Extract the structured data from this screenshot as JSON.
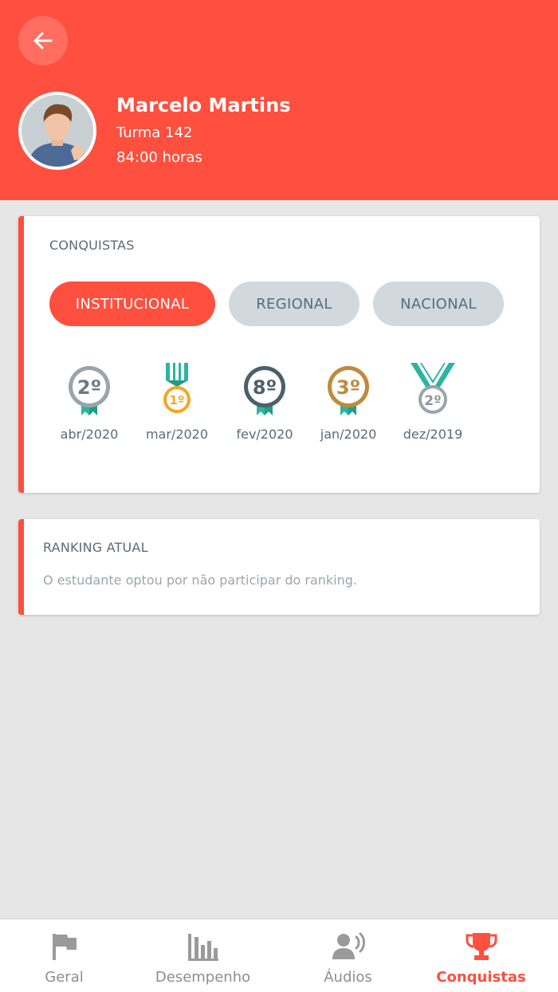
{
  "header": {
    "name": "Marcelo Martins",
    "class": "Turma 142",
    "hours": "84:00 horas",
    "color": "#ff4f3e"
  },
  "achievements": {
    "title": "CONQUISTAS",
    "tabs": [
      {
        "label": "INSTITUCIONAL",
        "active": true
      },
      {
        "label": "REGIONAL",
        "active": false
      },
      {
        "label": "NACIONAL",
        "active": false
      }
    ],
    "medals": [
      {
        "rank": "2º",
        "date": "abr/2020",
        "color": "#6e7a82"
      },
      {
        "rank": "1º",
        "date": "mar/2020",
        "color": "#f6a623"
      },
      {
        "rank": "8º",
        "date": "fev/2020",
        "color": "#4d5f6b"
      },
      {
        "rank": "3º",
        "date": "jan/2020",
        "color": "#c08a3e"
      },
      {
        "rank": "2º",
        "date": "dez/2019",
        "color": "#8e979c"
      }
    ]
  },
  "ranking": {
    "title": "RANKING ATUAL",
    "message": "O estudante optou por não participar do ranking."
  },
  "nav": {
    "items": [
      {
        "label": "Geral",
        "icon": "flag-icon",
        "active": false
      },
      {
        "label": "Desempenho",
        "icon": "bar-chart-icon",
        "active": false
      },
      {
        "label": "Áudios",
        "icon": "user-voice-icon",
        "active": false
      },
      {
        "label": "Conquistas",
        "icon": "trophy-icon",
        "active": true
      }
    ]
  }
}
